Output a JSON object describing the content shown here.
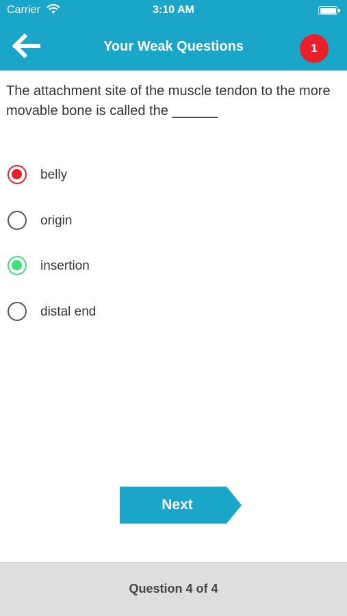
{
  "status_bar": {
    "carrier": "Carrier",
    "time": "3:10 AM",
    "icons": [
      "wifi-icon",
      "battery-icon"
    ]
  },
  "header": {
    "back_icon": "arrow-left-icon",
    "title": "Your Weak Questions",
    "badge_count": "1",
    "colors": {
      "bar": "#1aa6c8",
      "badge": "#e8202a"
    }
  },
  "question": {
    "text": "The attachment site of the muscle tendon to the more movable bone is called the ______"
  },
  "options": [
    {
      "label": "belly",
      "state": "wrong-selected"
    },
    {
      "label": "origin",
      "state": "unselected"
    },
    {
      "label": "insertion",
      "state": "correct"
    },
    {
      "label": "distal end",
      "state": "unselected"
    }
  ],
  "state_colors": {
    "wrong": "#e8202a",
    "correct": "#3ee07a",
    "unselected": "#555555"
  },
  "next_button": {
    "label": "Next"
  },
  "footer": {
    "progress_text": "Question 4 of 4",
    "current": 4,
    "total": 4
  }
}
